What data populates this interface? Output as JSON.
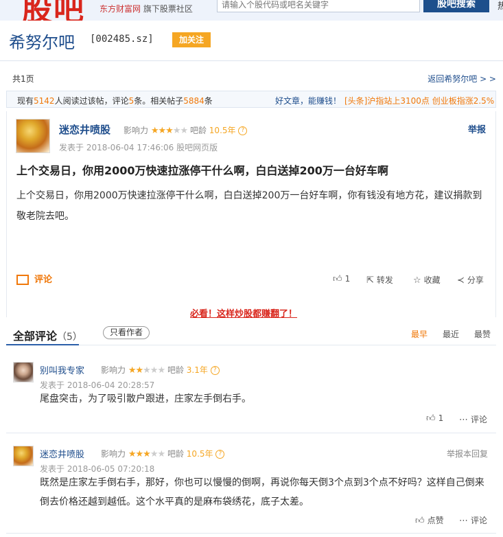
{
  "header": {
    "logo": "股吧",
    "brand_main": "东方财富网",
    "brand_sub": "旗下股票社区",
    "search_placeholder": "请输入个股代码或吧名关键字",
    "search_button": "股吧搜索",
    "topright": "热"
  },
  "bar": {
    "name": "希努尔吧",
    "code": "[002485.sz]",
    "follow": "加关注",
    "total_pages": "共1页",
    "back_link": "返回希努尔吧 > >"
  },
  "stats": {
    "prefix": "现有",
    "views": "5142",
    "mid1": "人阅读过该帖，评论",
    "comments": "5",
    "mid2": "条。相关帖子",
    "related": "5884",
    "suffix": "条",
    "good_article": "好文章，能赚钱！",
    "headline": "[头条]沪指站上3100点 创业板指涨2.5%"
  },
  "post": {
    "author": "迷恋井喷股",
    "influence_label": "影响力",
    "influence_stars": 3,
    "age_label": "吧龄",
    "age": "10.5年",
    "posted": "发表于 2018-06-04 17:46:06 股吧网页版",
    "report": "举报",
    "title": "上个交易日，你用2000万快速拉涨停干什么啊，白白送掉200万一台好车啊",
    "body": "上个交易日，你用2000万快速拉涨停干什么啊，白白送掉200万一台好车啊，你有钱没有地方花，建议捐款到敬老院去吧。",
    "comment_label": "评论",
    "likes": "1",
    "forward": "转发",
    "favorite": "收藏",
    "share": "分享"
  },
  "promo": "必看！这样炒股都赚翻了！",
  "comments_header": {
    "title": "全部评论",
    "count": "（5）",
    "only_author": "只看作者",
    "sort_earliest": "最早",
    "sort_latest": "最近",
    "sort_liked": "最赞"
  },
  "comments": [
    {
      "author": "别叫我专家",
      "influence_label": "影响力",
      "stars": 2,
      "age_label": "吧龄",
      "age": "3.1年",
      "posted": "发表于 2018-06-04 20:28:57",
      "text": "尾盘突击，为了吸引散户跟进，庄家左手倒右手。",
      "likes": "1",
      "reply": "评论"
    },
    {
      "author": "迷恋井喷股",
      "influence_label": "影响力",
      "stars": 3,
      "age_label": "吧龄",
      "age": "10.5年",
      "posted": "发表于 2018-06-05 07:20:18",
      "report_reply": "举报本回复",
      "text": "既然是庄家左手倒右手，那好，你也可以慢慢的倒啊，再说你每天倒3个点到3个点不好吗？这样自己倒来倒去价格还越到越低。这个水平真的是麻布袋绣花，底子太差。",
      "like_label": "点赞",
      "reply": "评论"
    }
  ]
}
